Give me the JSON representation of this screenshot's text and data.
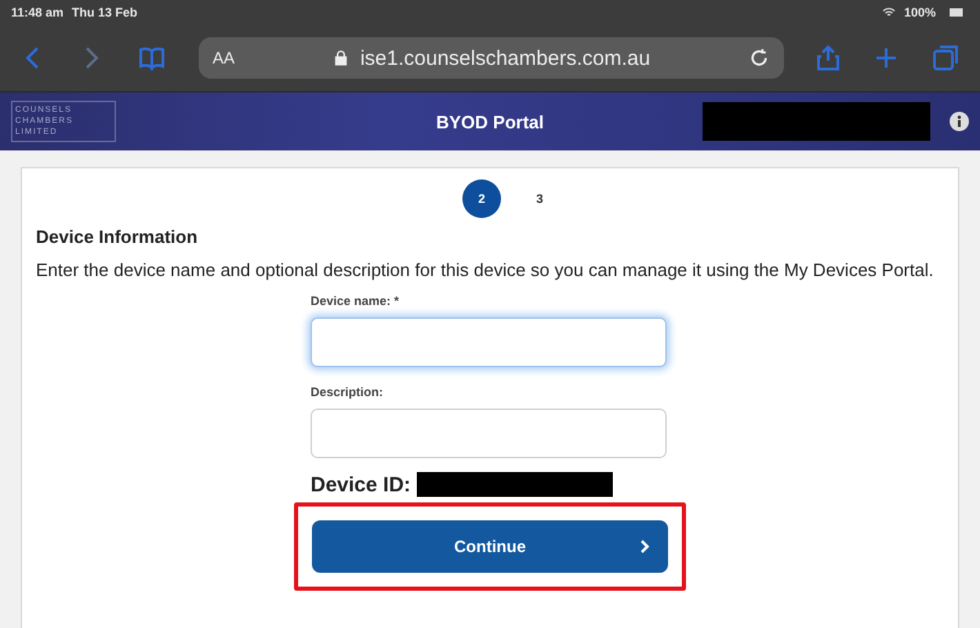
{
  "status_bar": {
    "time": "11:48 am",
    "date": "Thu 13 Feb",
    "battery": "100%"
  },
  "browser": {
    "text_size": "AA",
    "url": "ise1.counselschambers.com.au"
  },
  "banner": {
    "logo_lines": [
      "COUNSELS",
      "CHAMBERS",
      "LIMITED"
    ],
    "title": "BYOD Portal"
  },
  "steps": [
    {
      "label": "2",
      "selected": true
    },
    {
      "label": "3",
      "selected": false
    }
  ],
  "section": {
    "heading": "Device Information",
    "description": "Enter the device name and optional description for this device so you can manage it using the My Devices Portal."
  },
  "fields": [
    {
      "label": "Device name: *",
      "focused": true
    },
    {
      "label": "Description:",
      "focused": false
    }
  ],
  "device_id": {
    "label": "Device ID:"
  },
  "continue_button": {
    "label": "Continue",
    "highlighted": true
  }
}
